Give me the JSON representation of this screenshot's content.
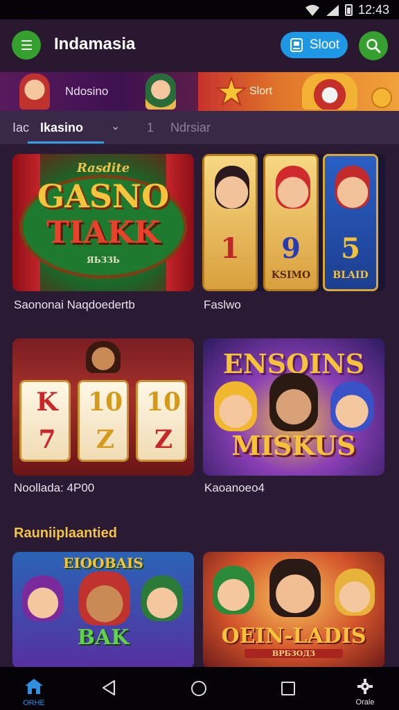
{
  "status_bar": {
    "time": "12:43"
  },
  "header": {
    "title": "Indamasia",
    "sloot_label": "Sloot"
  },
  "promo": {
    "left_text": "Ndosino",
    "right_text": "Slort"
  },
  "tabs": [
    {
      "label": "Iac",
      "active": false
    },
    {
      "label": "Ikasino",
      "active": true
    },
    {
      "label": "1",
      "active": false
    },
    {
      "label": "Ndrsiar",
      "active": false
    }
  ],
  "games": [
    {
      "label": "Saononai Naqdoedertb",
      "art_title": "GASNO",
      "art_sub": "TIAKK",
      "art_top": "Rasdite",
      "art_small": "ЯЬЗЗЬ"
    },
    {
      "label": "Faslwo",
      "reels": [
        "1",
        "9",
        "5"
      ],
      "reel_labels": [
        "",
        "KSIMO",
        "BLAID"
      ]
    },
    {
      "label": "Noollada: 4P00",
      "symbols_top": [
        "K",
        "10",
        "10"
      ],
      "symbols_bottom": [
        "7",
        "Z",
        "Z"
      ]
    },
    {
      "label": "Kaoanoeo4",
      "art_title": "ENSOINS",
      "art_sub": "MISKUS"
    }
  ],
  "section": {
    "title": "Rauniiplaantied"
  },
  "featured": [
    {
      "art_top": "EIOOBAIS",
      "art_title": "BAK"
    },
    {
      "art_title": "OEIN-LADIS",
      "art_sub": "ВРБЗОДЗ"
    }
  ],
  "nav": {
    "home_label": "ORHE",
    "game_label": "Orale"
  },
  "colors": {
    "accent_green": "#35a02e",
    "accent_blue": "#1e97e5",
    "tab_underline": "#2fa3e8",
    "section_gold": "#f4c542",
    "background": "#2b1a33"
  }
}
